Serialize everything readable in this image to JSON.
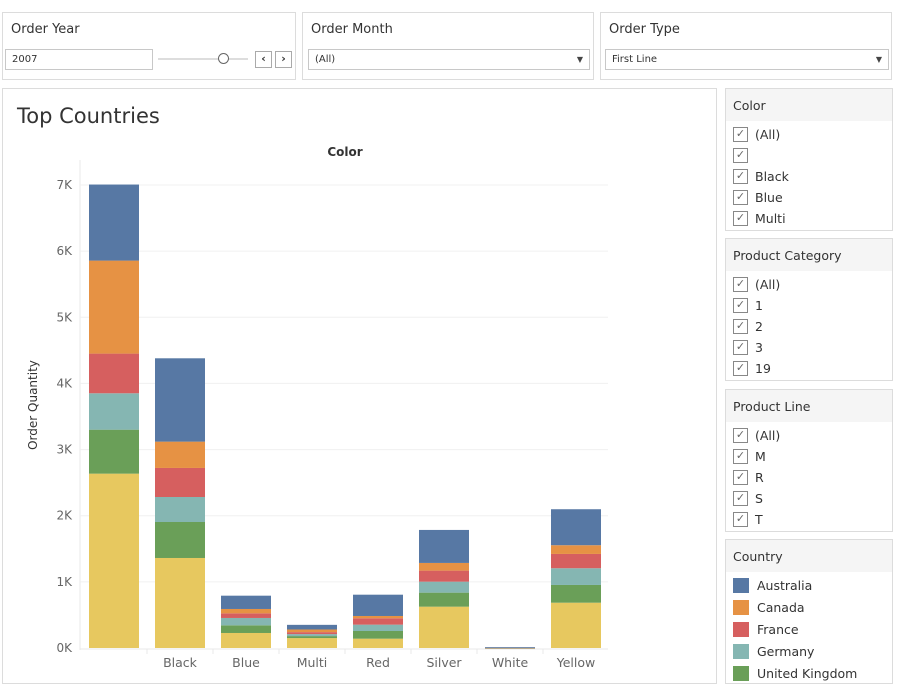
{
  "filters": {
    "order_year": {
      "title": "Order Year",
      "value": "2007"
    },
    "order_month": {
      "title": "Order Month",
      "value": "(All)"
    },
    "order_type": {
      "title": "Order Type",
      "value": "First Line"
    }
  },
  "sheet_title": "Top Countries",
  "color_filter": {
    "title": "Color",
    "items": [
      "(All)",
      "",
      "Black",
      "Blue",
      "Multi"
    ]
  },
  "category_filter": {
    "title": "Product Category",
    "items": [
      "(All)",
      "1",
      "2",
      "3",
      "19"
    ]
  },
  "line_filter": {
    "title": "Product Line",
    "items": [
      "(All)",
      "M",
      "R",
      "S",
      "T"
    ]
  },
  "legend": {
    "title": "Country",
    "items": [
      {
        "label": "Australia",
        "color": "#5778a4"
      },
      {
        "label": "Canada",
        "color": "#e69244"
      },
      {
        "label": "France",
        "color": "#d65f5f"
      },
      {
        "label": "Germany",
        "color": "#85b6b2"
      },
      {
        "label": "United Kingdom",
        "color": "#6a9f58"
      }
    ]
  },
  "chart_data": {
    "type": "bar",
    "stacked": true,
    "title": "Color",
    "xlabel": "",
    "ylabel": "Order Quantity",
    "ylim": [
      0,
      7000
    ],
    "yticks": [
      "0K",
      "1K",
      "2K",
      "3K",
      "4K",
      "5K",
      "6K",
      "7K"
    ],
    "grid": true,
    "categories": [
      "",
      "Black",
      "Blue",
      "Multi",
      "Red",
      "Silver",
      "White",
      "Yellow"
    ],
    "series": [
      {
        "color": "#e7c85f",
        "values": [
          2636,
          1361,
          227,
          150,
          141,
          625,
          5,
          685
        ]
      },
      {
        "name": "United Kingdom",
        "color": "#6a9f58",
        "values": [
          665,
          544,
          116,
          30,
          116,
          212,
          1,
          268
        ]
      },
      {
        "name": "Germany",
        "color": "#85b6b2",
        "values": [
          550,
          378,
          111,
          30,
          96,
          166,
          1,
          253
        ]
      },
      {
        "name": "France",
        "color": "#d65f5f",
        "values": [
          600,
          439,
          70,
          30,
          96,
          167,
          1,
          216
        ]
      },
      {
        "name": "Canada",
        "color": "#e69244",
        "values": [
          1406,
          398,
          66,
          40,
          35,
          116,
          1,
          132
        ]
      },
      {
        "name": "Australia",
        "color": "#5778a4",
        "values": [
          1150,
          1260,
          201,
          70,
          322,
          499,
          3,
          544
        ]
      }
    ]
  }
}
